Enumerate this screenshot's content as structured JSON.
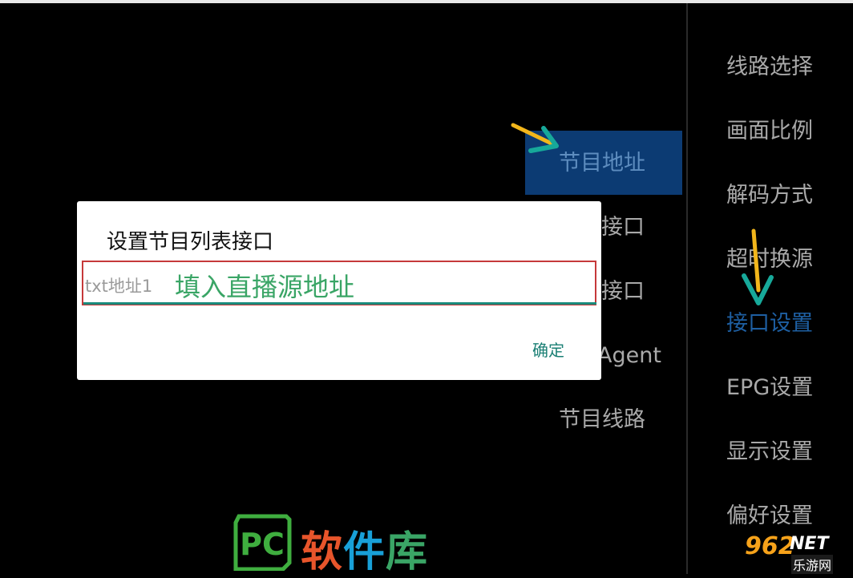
{
  "sidebar": {
    "items": [
      {
        "label": "线路选择"
      },
      {
        "label": "画面比例"
      },
      {
        "label": "解码方式"
      },
      {
        "label": "超时换源"
      },
      {
        "label": "接口设置",
        "active": true
      },
      {
        "label": "EPG设置"
      },
      {
        "label": "显示设置"
      },
      {
        "label": "偏好设置"
      }
    ]
  },
  "submenu": {
    "items": [
      {
        "label": "节目地址",
        "active": true
      },
      {
        "label": "接口"
      },
      {
        "label": "接口"
      },
      {
        "label": "Agent"
      },
      {
        "label": "节目线路"
      }
    ]
  },
  "dialog": {
    "title": "设置节目列表接口",
    "input_placeholder": "txt地址1",
    "annotation": "填入直播源地址",
    "ok_label": "确定"
  },
  "watermark": {
    "pc_logo_text": "PC",
    "brand_part1": "软",
    "brand_part2": "件",
    "brand_part3": "库",
    "badge_number": "962",
    "badge_net": "NET",
    "badge_sub": "乐游网"
  },
  "colors": {
    "active_blue": "#1e5fa2",
    "highlight_bg": "#0c3b73",
    "accent_teal": "#1a8b7c",
    "annotation_green": "#3aa566",
    "annotation_box_red": "#c6393a",
    "arrow_yellow": "#f2b61b"
  }
}
